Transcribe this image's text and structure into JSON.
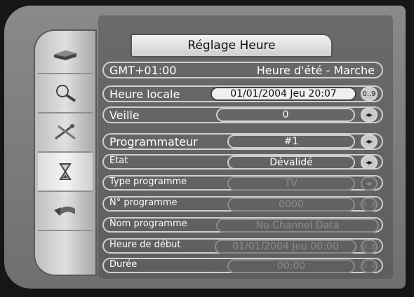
{
  "title": "Réglage Heure",
  "header": {
    "gmt": "GMT+01:00",
    "summer": "Heure d'été - Marche"
  },
  "rows": {
    "local_time": {
      "label": "Heure locale",
      "value": "01/01/2004 Jeu 20:07",
      "btn": "0..9"
    },
    "standby": {
      "label": "Veille",
      "value": "0"
    },
    "scheduler": {
      "label": "Programmateur",
      "value": "#1"
    },
    "state": {
      "label": "Etat",
      "value": "Dévalidé"
    },
    "prog_type": {
      "label": "Type programme",
      "value": "TV"
    },
    "prog_no": {
      "label": "N° programme",
      "value": "0000",
      "btn": "0..9"
    },
    "prog_name": {
      "label": "Nom programme",
      "value": "No Channel Data"
    },
    "start": {
      "label": "Heure de début",
      "value": "01/01/2004 Jeu 00:00",
      "btn": "0..9"
    },
    "duration": {
      "label": "Durée",
      "value": "00:00",
      "btn": "0..9"
    }
  },
  "sidebar": [
    "receiver-icon",
    "search-icon",
    "tools-icon",
    "hourglass-icon",
    "return-icon"
  ]
}
